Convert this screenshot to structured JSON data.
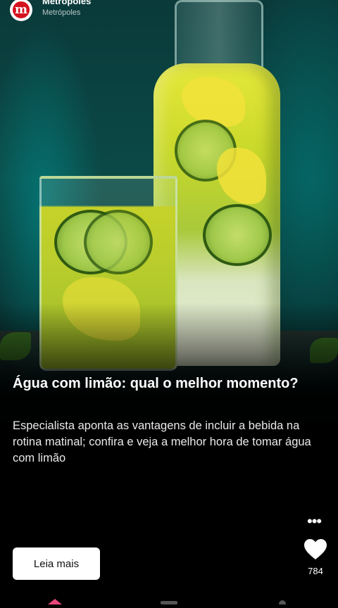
{
  "header": {
    "logo_letter": "m",
    "account_name": "Metrópoles",
    "account_handle": "Metrópoles"
  },
  "post": {
    "title": "Água com limão: qual o melhor momento?",
    "description": "Especialista aponta as vantagens de incluir a bebida na rotina matinal; confira e veja a melhor hora de tomar água com limão",
    "cta_label": "Leia mais",
    "more_label": "•••",
    "likes": "784"
  },
  "colors": {
    "brand_red": "#d4121e",
    "background": "#000000",
    "button_bg": "#ffffff"
  },
  "icons": [
    "metropoles-logo-icon",
    "more-options-icon",
    "heart-icon"
  ]
}
